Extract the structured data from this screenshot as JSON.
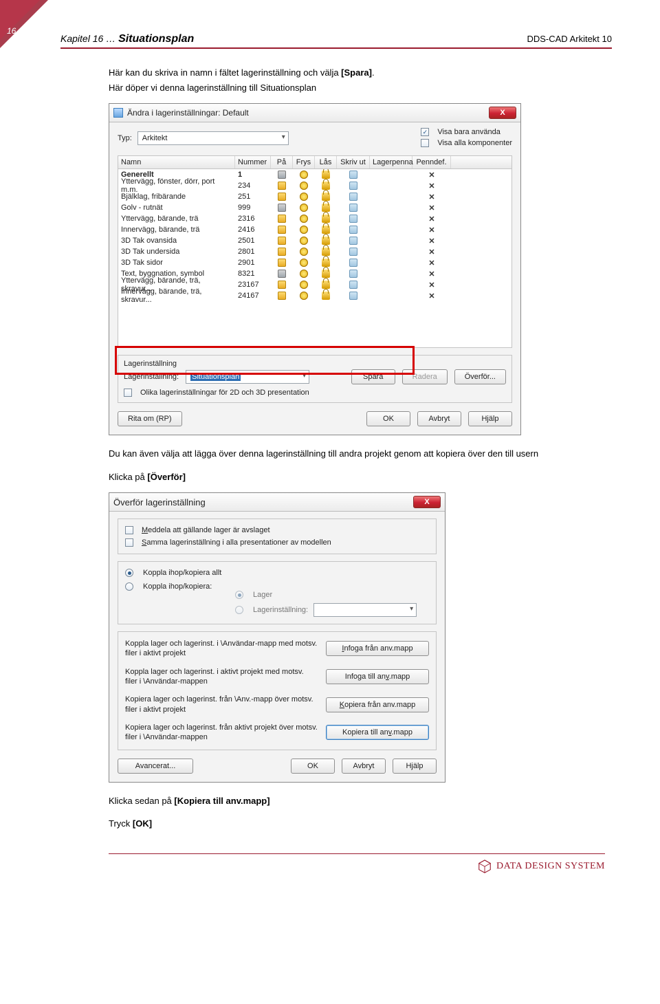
{
  "page": {
    "number": "16",
    "chapter": "Kapitel 16 … ",
    "title": "Situationsplan",
    "right": "DDS-CAD Arkitekt 10"
  },
  "intro": {
    "line1a": "Här kan du skriva in namn i fältet lagerinställning och välja ",
    "line1b": "[Spara]",
    "line1c": ".",
    "line2": "Här döper vi denna lagerinställning till Situationsplan"
  },
  "dlg1": {
    "title": "Ändra i lagerinställningar: Default",
    "typ_label": "Typ:",
    "typ_value": "Arkitekt",
    "opt_visa_anvanda": "Visa bara använda",
    "opt_visa_alla": "Visa alla komponenter",
    "headers": {
      "name": "Namn",
      "num": "Nummer",
      "pa": "På",
      "frys": "Frys",
      "las": "Lås",
      "skriv": "Skriv ut",
      "lp": "Lagerpenna",
      "pd": "Penndef."
    },
    "rows": [
      {
        "name": "Generellt",
        "num": "1",
        "bold": true,
        "pa": false
      },
      {
        "name": "Yttervägg, fönster, dörr, port m.m.",
        "num": "234"
      },
      {
        "name": "Bjälklag, fribärande",
        "num": "251"
      },
      {
        "name": "Golv - rutnät",
        "num": "999",
        "pa": false
      },
      {
        "name": "Yttervägg, bärande, trä",
        "num": "2316"
      },
      {
        "name": "Innervägg, bärande, trä",
        "num": "2416"
      },
      {
        "name": "3D Tak ovansida",
        "num": "2501"
      },
      {
        "name": "3D Tak undersida",
        "num": "2801"
      },
      {
        "name": "3D Tak sidor",
        "num": "2901"
      },
      {
        "name": "Text, byggnation, symbol",
        "num": "8321",
        "pa": false
      },
      {
        "name": "Yttervägg, bärande, trä, skravur...",
        "num": "23167"
      },
      {
        "name": "Innervägg, bärande, trä, skravur...",
        "num": "24167"
      }
    ],
    "fs_legend": "Lagerinställning",
    "fs_label": "Lagerinställning:",
    "fs_value": "Situationsplan",
    "btn_spara": "Spara",
    "btn_radera": "Radera",
    "btn_overfor": "Överför...",
    "chk_olika": "Olika lagerinställningar för 2D och 3D presentation",
    "btn_rita": "Rita om (RP)",
    "btn_ok": "OK",
    "btn_avbryt": "Avbryt",
    "btn_hjalp": "Hjälp"
  },
  "mid": {
    "para": "Du kan även välja att lägga över denna lagerinställning till andra projekt genom att kopiera över den till usern",
    "click_a": "Klicka på ",
    "click_b": "[Överför]"
  },
  "dlg2": {
    "title": "Överför lagerinställning",
    "chk1_a": "M",
    "chk1_b": "eddela att gällande lager är avslaget",
    "chk2_a": "S",
    "chk2_b": "amma lagerinställning i alla presentationer av modellen",
    "r1": "Koppla ihop/kopiera allt",
    "r2": "Koppla ihop/kopiera:",
    "sub_lager": "Lager",
    "sub_li": "Lagerinställning:",
    "p1": "Koppla lager och lagerinst. i \\Användar-mapp med motsv. filer i aktivt projekt",
    "b1_a": "I",
    "b1_b": "nfoga från anv.mapp",
    "p2": "Koppla lager och lagerinst. i aktivt projekt med motsv. filer i \\Användar-mappen",
    "b2_a": "Infoga till an",
    "b2_u": "v",
    "b2_c": ".mapp",
    "p3": "Kopiera lager och lagerinst. från \\Anv.-mapp över motsv. filer i aktivt projekt",
    "b3_a": "K",
    "b3_b": "opiera från anv.mapp",
    "p4": "Kopiera lager och lagerinst. från aktivt projekt över motsv. filer i \\Användar-mappen",
    "b4_a": "Kopiera till an",
    "b4_u": "v",
    "b4_c": ".mapp",
    "btn_adv": "Avancerat...",
    "btn_ok": "OK",
    "btn_avbryt": "Avbryt",
    "btn_hjalp": "Hjälp"
  },
  "outro": {
    "l1a": "Klicka sedan på ",
    "l1b": "[Kopiera till anv.mapp]",
    "l2a": "Tryck ",
    "l2b": "[OK]"
  },
  "footer": {
    "brand": "DATA DESIGN SYSTEM"
  }
}
